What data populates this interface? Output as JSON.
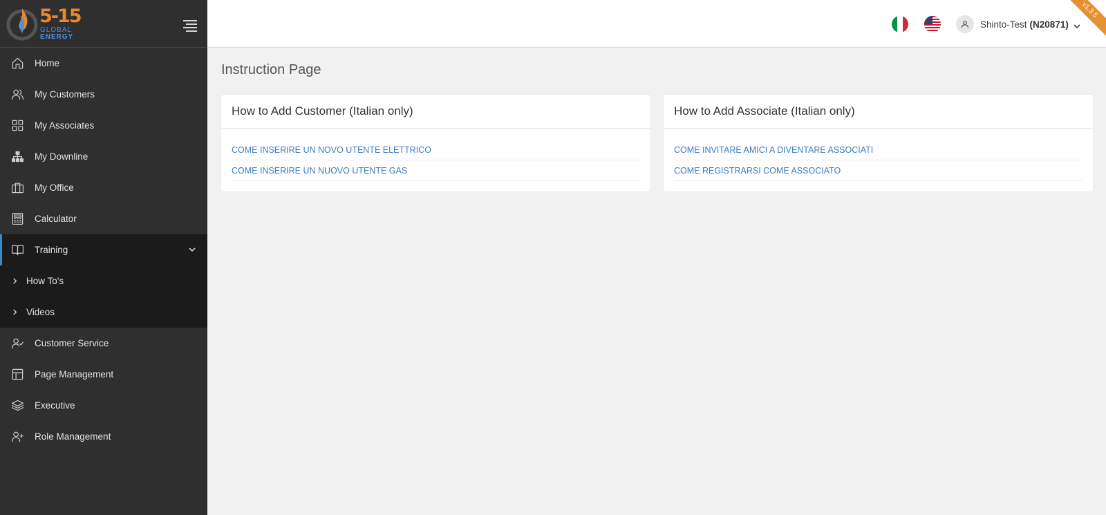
{
  "sidebar": {
    "logo": {
      "big": "5-15",
      "line1": "GLOBAL",
      "line2": "ENERGY"
    },
    "items": [
      {
        "label": "Home",
        "icon": "home-icon"
      },
      {
        "label": "My Customers",
        "icon": "users-icon"
      },
      {
        "label": "My Associates",
        "icon": "grid-icon"
      },
      {
        "label": "My Downline",
        "icon": "hierarchy-icon"
      },
      {
        "label": "My Office",
        "icon": "briefcase-icon"
      },
      {
        "label": "Calculator",
        "icon": "calculator-icon"
      },
      {
        "label": "Training",
        "icon": "book-icon",
        "expanded": true
      },
      {
        "label": "Customer Service",
        "icon": "user-check-icon"
      },
      {
        "label": "Page Management",
        "icon": "layout-icon"
      },
      {
        "label": "Executive",
        "icon": "layers-icon"
      },
      {
        "label": "Role Management",
        "icon": "user-plus-icon"
      }
    ],
    "training_sub": [
      {
        "label": "How To's"
      },
      {
        "label": "Videos"
      }
    ],
    "active_color": "#3b88c9"
  },
  "topbar": {
    "user_name": "Shinto-Test",
    "user_id": "(N20871)",
    "version": "v1.3.5",
    "flags": [
      "italy-flag-icon",
      "usa-flag-icon"
    ]
  },
  "main": {
    "title": "Instruction Page",
    "cards": [
      {
        "title": "How to Add Customer (Italian only)",
        "links": [
          "COME INSERIRE UN NOVO UTENTE ELETTRICO",
          "COME INSERIRE UN NUOVO UTENTE GAS"
        ]
      },
      {
        "title": "How to Add Associate (Italian only)",
        "links": [
          "COME INVITARE AMICI A DIVENTARE ASSOCIATI",
          "COME REGISTRARSI COME ASSOCIATO"
        ]
      }
    ]
  }
}
